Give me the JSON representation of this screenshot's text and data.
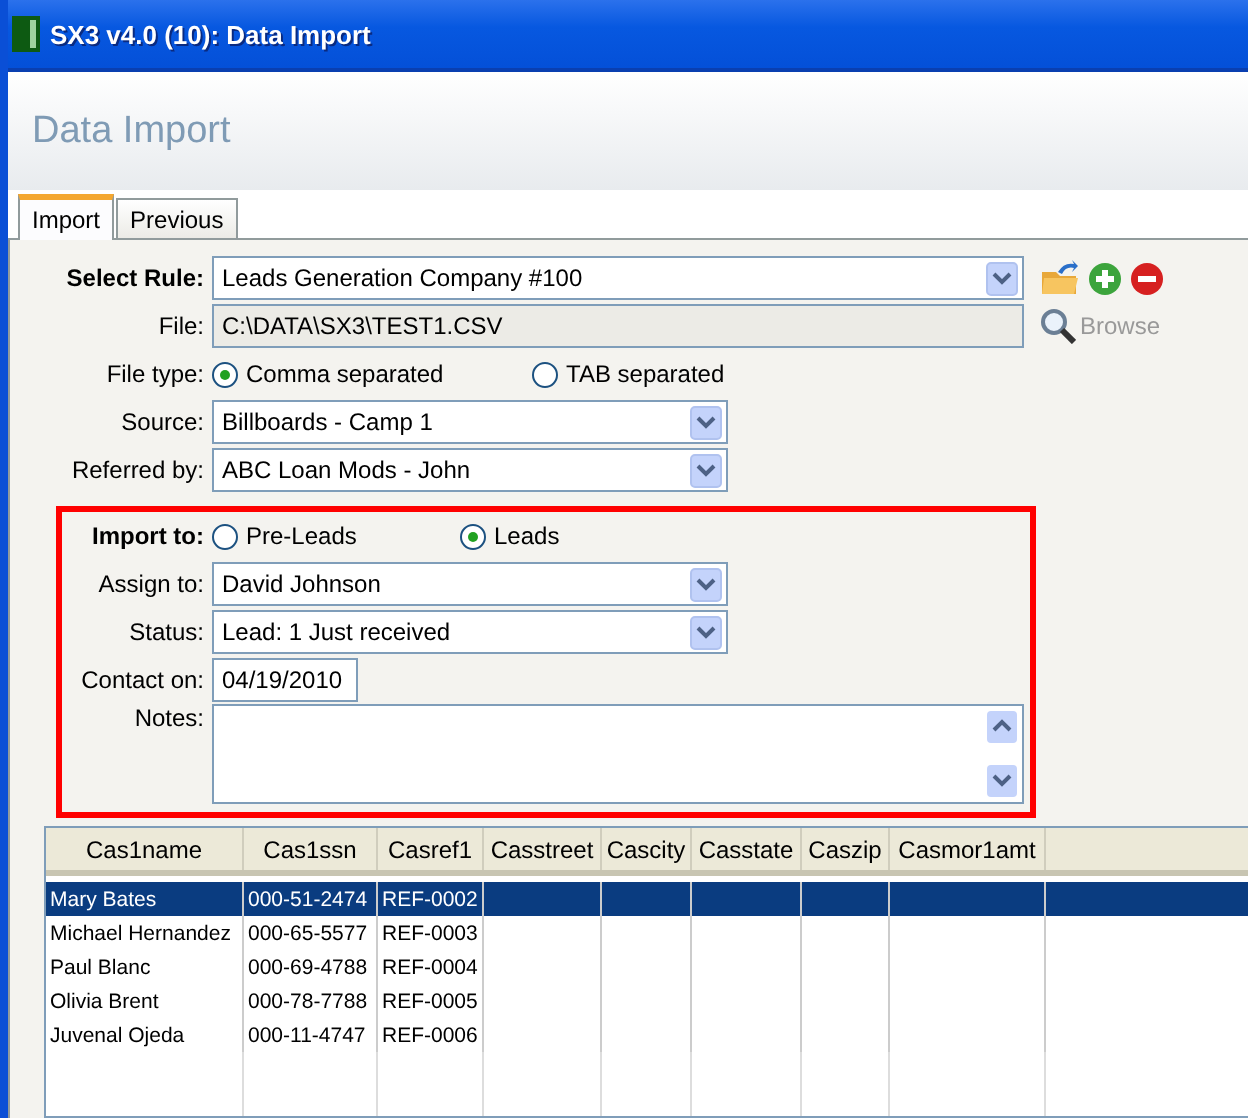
{
  "window": {
    "title": "SX3 v4.0 (10): Data Import"
  },
  "header": "Data Import",
  "tabs": [
    {
      "label": "Import",
      "selected": true
    },
    {
      "label": "Previous",
      "selected": false
    }
  ],
  "rule": {
    "label": "Select Rule:",
    "value": "Leads Generation Company #100"
  },
  "file": {
    "label": "File:",
    "value": "C:\\DATA\\SX3\\TEST1.CSV",
    "browse": "Browse"
  },
  "file_type": {
    "label": "File type:",
    "options": [
      {
        "label": "Comma separated",
        "selected": true
      },
      {
        "label": "TAB separated",
        "selected": false
      }
    ]
  },
  "source": {
    "label": "Source:",
    "value": "Billboards - Camp 1"
  },
  "referred_by": {
    "label": "Referred by:",
    "value": "ABC Loan Mods - John"
  },
  "import_to": {
    "label": "Import to:",
    "options": [
      {
        "label": "Pre-Leads",
        "selected": false
      },
      {
        "label": "Leads",
        "selected": true
      }
    ]
  },
  "assign_to": {
    "label": "Assign to:",
    "value": "David Johnson"
  },
  "status": {
    "label": "Status:",
    "value": "Lead: 1 Just received"
  },
  "contact_on": {
    "label": "Contact on:",
    "value": "04/19/2010"
  },
  "notes": {
    "label": "Notes:"
  },
  "table": {
    "columns": [
      "Cas1name",
      "Cas1ssn",
      "Casref1",
      "Casstreet",
      "Cascity",
      "Casstate",
      "Caszip",
      "Casmor1amt"
    ],
    "rows": [
      {
        "cells": [
          "Mary Bates",
          "000-51-2474",
          "REF-0002"
        ],
        "selected": true
      },
      {
        "cells": [
          "Michael Hernandez",
          "000-65-5577",
          "REF-0003"
        ],
        "selected": false
      },
      {
        "cells": [
          "Paul Blanc",
          "000-69-4788",
          "REF-0004"
        ],
        "selected": false
      },
      {
        "cells": [
          "Olivia Brent",
          "000-78-7788",
          "REF-0005"
        ],
        "selected": false
      },
      {
        "cells": [
          "Juvenal Ojeda",
          "000-11-4747",
          "REF-0006"
        ],
        "selected": false
      }
    ]
  }
}
